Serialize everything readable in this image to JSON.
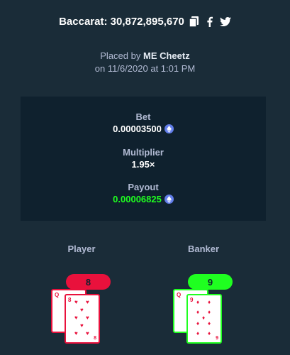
{
  "header": {
    "title": "Baccarat: 30,872,895,670"
  },
  "placed": {
    "prefix": "Placed by",
    "user": "ME Cheetz",
    "date": "on 11/6/2020 at 1:01 PM"
  },
  "stats": {
    "bet_label": "Bet",
    "bet_value": "0.00003500",
    "multiplier_label": "Multiplier",
    "multiplier_value": "1.95×",
    "payout_label": "Payout",
    "payout_value": "0.00006825"
  },
  "player": {
    "label": "Player",
    "score": "8",
    "cards": [
      {
        "rank": "Q"
      },
      {
        "rank": "8"
      }
    ]
  },
  "banker": {
    "label": "Banker",
    "score": "9",
    "cards": [
      {
        "rank": "Q"
      },
      {
        "rank": "9"
      }
    ]
  },
  "colors": {
    "background": "#1a2c38",
    "panel": "#0f212e",
    "player_accent": "#e9113c",
    "banker_accent": "#1fff20",
    "eth": "#627eea"
  },
  "icons": [
    "copy-icon",
    "facebook-icon",
    "twitter-icon",
    "eth-icon",
    "heart-suit-icon",
    "diamond-suit-icon"
  ]
}
